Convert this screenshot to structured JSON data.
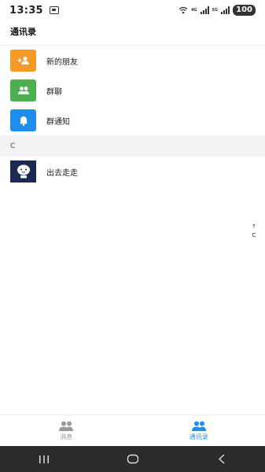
{
  "status_bar": {
    "time": "13:35",
    "network_labels": [
      "4G",
      "5G"
    ],
    "battery": "100"
  },
  "page_title": "通讯录",
  "menu": [
    {
      "label": "新的朋友",
      "icon": "add-person-icon",
      "color": "#f59a23"
    },
    {
      "label": "群聊",
      "icon": "group-icon",
      "color": "#4caf50"
    },
    {
      "label": "群通知",
      "icon": "bell-icon",
      "color": "#1e8df0"
    }
  ],
  "sections": [
    {
      "letter": "C",
      "contacts": [
        {
          "name": "出去走走",
          "avatar_bg": "#1b2a55"
        }
      ]
    }
  ],
  "index_bar": [
    "↑",
    "C"
  ],
  "bottom_nav": {
    "tabs": [
      {
        "label": "消息",
        "icon": "people-icon",
        "active": false
      },
      {
        "label": "通讯录",
        "icon": "contacts-icon",
        "active": true
      }
    ],
    "active_color": "#1e8df0",
    "inactive_color": "#999999"
  },
  "system_nav": [
    "recent-apps-icon",
    "home-icon",
    "back-icon"
  ]
}
